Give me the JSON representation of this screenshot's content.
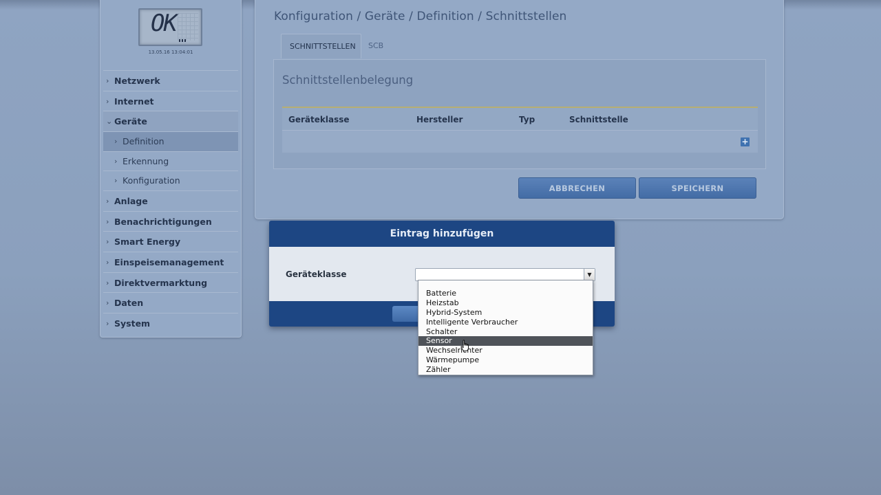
{
  "sidebar": {
    "lcd_display": "OK",
    "timestamp": "13.05.16 13:04:01",
    "items": [
      {
        "label": "Netzwerk"
      },
      {
        "label": "Internet"
      },
      {
        "label": "Geräte"
      },
      {
        "label": "Definition"
      },
      {
        "label": "Erkennung"
      },
      {
        "label": "Konfiguration"
      },
      {
        "label": "Anlage"
      },
      {
        "label": "Benachrichtigungen"
      },
      {
        "label": "Smart Energy"
      },
      {
        "label": "Einspeisemanagement"
      },
      {
        "label": "Direktvermarktung"
      },
      {
        "label": "Daten"
      },
      {
        "label": "System"
      }
    ]
  },
  "main": {
    "breadcrumb": "Konfiguration / Geräte / Definition / Schnittstellen",
    "tabs": [
      {
        "label": "SCHNITTSTELLEN"
      },
      {
        "label": "SCB"
      }
    ],
    "section_title": "Schnittstellenbelegung",
    "table": {
      "columns": [
        "Geräteklasse",
        "Hersteller",
        "Typ",
        "Schnittstelle"
      ],
      "add_icon": "plus-icon"
    },
    "buttons": {
      "cancel": "ABBRECHEN",
      "save": "SPEICHERN"
    }
  },
  "modal": {
    "title": "Eintrag hinzufügen",
    "field_label": "Geräteklasse",
    "selected_value": "",
    "options": [
      "Batterie",
      "Heizstab",
      "Hybrid-System",
      "Intelligente Verbraucher",
      "Schalter",
      "Sensor",
      "Wechselrichter",
      "Wärmepumpe",
      "Zähler"
    ],
    "hovered_option": "Sensor"
  },
  "colors": {
    "background": "#8fa4c2",
    "modal_header": "#1d4683",
    "button": "#4a74ad",
    "dropdown_hover": "#4f5359",
    "table_accent": "#b7ae72"
  }
}
